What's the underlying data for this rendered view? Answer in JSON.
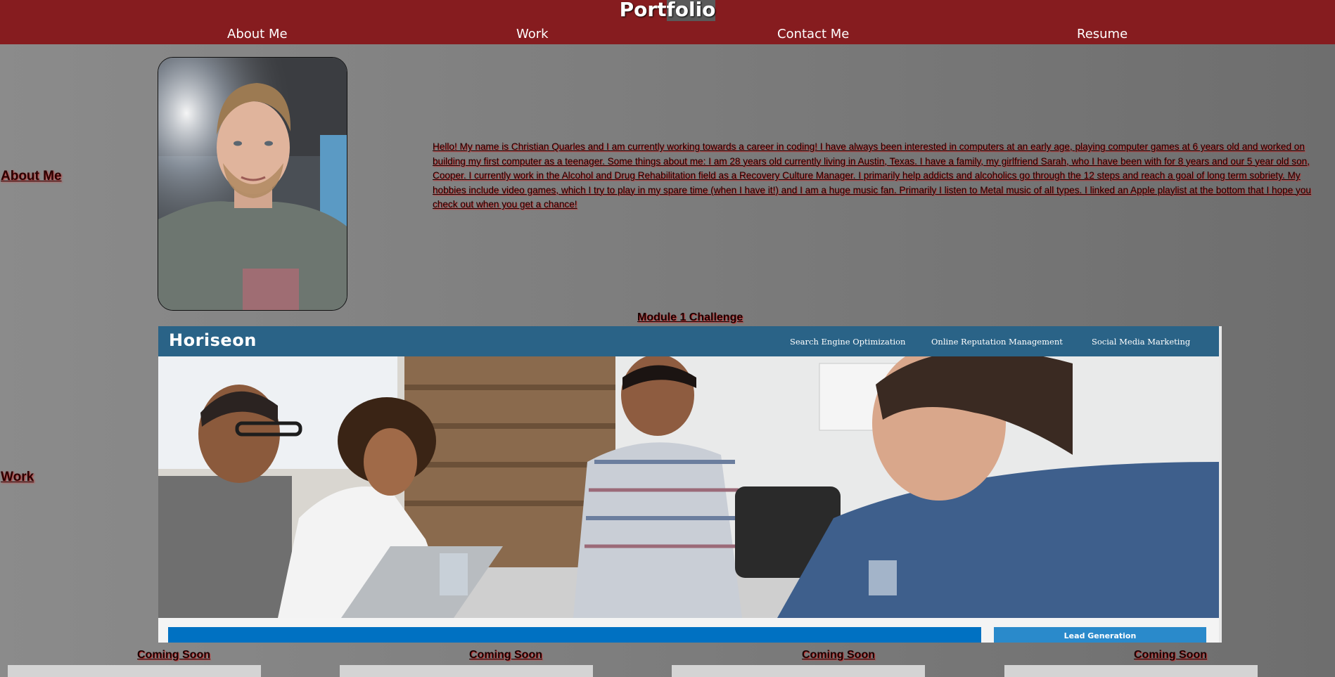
{
  "header": {
    "title_part1": "Port",
    "title_part2": "folio",
    "nav": [
      {
        "label": "About Me"
      },
      {
        "label": "Work"
      },
      {
        "label": "Contact Me"
      },
      {
        "label": "Resume"
      }
    ]
  },
  "about": {
    "label": "About Me",
    "bio": "Hello! My name is Christian Quarles and I am currently working towards a career in coding! I have always been interested in computers at an early age, playing computer games at 6 years old and worked on building my first computer as a teenager. Some things about me: I am 28 years old currently living in Austin, Texas. I have a family, my girlfriend Sarah, who I have been with for 8 years and our 5 year old son, Cooper. I currently work in the Alcohol and Drug Rehabilitation field as a Recovery Culture Manager. I primarily help addicts and alcoholics go through the 12 steps and reach a goal of long term sobriety. My hobbies include video games, which I try to play in my spare time (when I have it!) and I am a huge music fan. Primarily I listen to Metal music of all types. I linked an Apple playlist at the bottom that I hope you check out when you get a chance!"
  },
  "work": {
    "label": "Work",
    "project_title": "Module 1 Challenge",
    "screenshot": {
      "brand": "Horiseon",
      "nav": [
        "Search Engine Optimization",
        "Online Reputation Management",
        "Social Media Marketing"
      ],
      "cta": "Lead Generation"
    },
    "coming_soon": [
      "Coming Soon",
      "Coming Soon",
      "Coming Soon",
      "Coming Soon"
    ]
  },
  "colors": {
    "header_bg": "#861c1f",
    "page_bg": "#7a7a7a",
    "screenshot_header": "#2a6387",
    "screenshot_bar": "#0071c2"
  }
}
